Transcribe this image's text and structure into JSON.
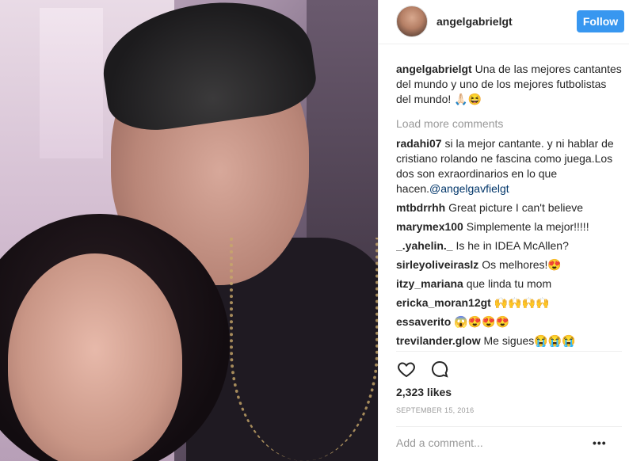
{
  "header": {
    "username": "angelgabrielgt",
    "follow_label": "Follow"
  },
  "caption": {
    "username": "angelgabrielgt",
    "text": "Una de las mejores cantantes del mundo y uno de los mejores futbolistas del mundo! 🙏🏻😆"
  },
  "load_more_label": "Load more comments",
  "comments": [
    {
      "user": "radahi07",
      "text": "si la mejor cantante. y ni hablar de cristiano rolando ne fascina como juega.Los dos son exraordinarios en lo que hacen.",
      "mention": "@angelgavfielgt"
    },
    {
      "user": "mtbdrrhh",
      "text": "Great picture I can't believe",
      "mention": ""
    },
    {
      "user": "marymex100",
      "text": "Simplemente la mejor!!!!!",
      "mention": ""
    },
    {
      "user": "_.yahelin._",
      "text": "Is he in IDEA McAllen?",
      "mention": ""
    },
    {
      "user": "sirleyoliveiraslz",
      "text": "Os melhores!😍",
      "mention": ""
    },
    {
      "user": "itzy_mariana",
      "text": "que linda tu mom",
      "mention": ""
    },
    {
      "user": "ericka_moran12gt",
      "text": "🙌🙌🙌🙌",
      "mention": ""
    },
    {
      "user": "essaverito",
      "text": "😱😍😍😍",
      "mention": ""
    },
    {
      "user": "trevilander.glow",
      "text": "Me sigues😭😭😭",
      "mention": ""
    }
  ],
  "actions": {
    "like_icon": "heart-icon",
    "comment_icon": "comment-bubble-icon"
  },
  "likes": "2,323 likes",
  "date": "SEPTEMBER 15, 2016",
  "add_comment_placeholder": "Add a comment...",
  "more_options_label": "•••",
  "colors": {
    "accent": "#3897f0",
    "text": "#262626",
    "muted": "#999999",
    "mention": "#003569"
  }
}
